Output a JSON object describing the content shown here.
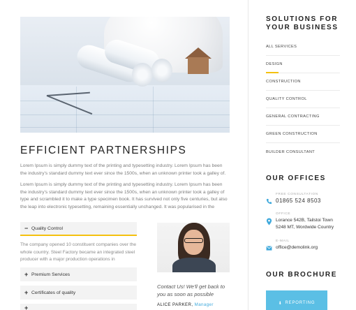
{
  "main": {
    "hero_alt": "blueprints-with-helmet",
    "title": "EFFICIENT PARTNERSHIPS",
    "paragraphs": [
      "Lorem Ipsum is simply dummy text of the printing and typesetting industry. Lorem Ipsum has been the industry's standard dummy text ever since the 1500s, when an unknown printer took a galley of.",
      "Lorem Ipsum is simply dummy text of the printing and typesetting industry. Lorem Ipsum has been the industry's standard dummy text ever since the 1500s, when an unknown printer took a galley of type and scrambled it to make a type specimen book. It has survived not only five centuries, but also the leap into electronic typesetting, remaining essentially unchanged. It was popularised in the"
    ],
    "accordion": {
      "items": [
        {
          "label": "Quality Control",
          "sign": "−"
        },
        {
          "label": "Premium Services",
          "sign": "+"
        },
        {
          "label": "Certificates of quality",
          "sign": "+"
        },
        {
          "label": "",
          "sign": "+"
        }
      ],
      "open_body": "The company opened 10 constituent companies over the whole country. Steel Factory became an integrated steel producer with a major production operations in"
    },
    "contact": {
      "note": "Contact Us! We'll get back to you as soon as possible",
      "name": "ALICE PARKER,",
      "role": "Manager"
    }
  },
  "sidebar": {
    "solutions_title_line1": "SOLUTIONS FOR",
    "solutions_title_line2": "YOUR BUSINESS",
    "nav": [
      "ALL SERVICES",
      "DESIGN",
      "CONSTRUCTION",
      "QUALITY CONTROL",
      "GENERAL CONTRACTING",
      "GREEN CONSTRUCTION",
      "BUILDER CONSULTANT"
    ],
    "active_index": 1,
    "offices_title": "OUR OFFICES",
    "offices": {
      "phone_label": "FREE CONSULTATION",
      "phone": "01865 524 8503",
      "address_label": "OFFICE",
      "address_line1": "Lorance 542B, Tailstoi Town",
      "address_line2": "5248 MT, Wordwide Country",
      "email_label": "E-MAIL",
      "email": "office@demolink.org"
    },
    "brochure_title": "OUR BROCHURE",
    "brochure_button": "REPORTING"
  },
  "colors": {
    "accent_yellow": "#f4c10f",
    "accent_blue": "#3fa9dc",
    "button_blue": "#5bbfe5"
  }
}
